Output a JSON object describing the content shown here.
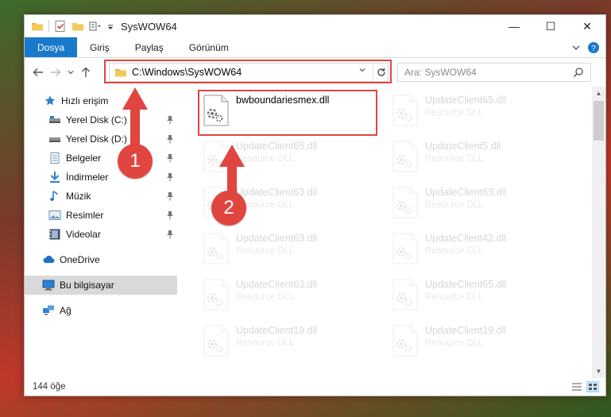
{
  "window": {
    "title": "SysWOW64",
    "controls": {
      "minimize": "—",
      "maximize": "☐",
      "close": "✕"
    }
  },
  "ribbon": {
    "tabs": [
      {
        "label": "Dosya",
        "active": true
      },
      {
        "label": "Giriş",
        "active": false
      },
      {
        "label": "Paylaş",
        "active": false
      },
      {
        "label": "Görünüm",
        "active": false
      }
    ]
  },
  "navigation": {
    "address": "C:\\Windows\\SysWOW64",
    "search_placeholder": "Ara: SysWOW64"
  },
  "sidebar": {
    "items": [
      {
        "label": "Hızlı erişim",
        "icon": "star-icon",
        "pinned": false
      },
      {
        "label": "Yerel Disk (C:)",
        "icon": "drive-icon",
        "pinned": true
      },
      {
        "label": "Yerel Disk (D:)",
        "icon": "drive-icon",
        "pinned": true
      },
      {
        "label": "Belgeler",
        "icon": "documents-icon",
        "pinned": true
      },
      {
        "label": "İndirmeler",
        "icon": "download-icon",
        "pinned": true
      },
      {
        "label": "Müzik",
        "icon": "music-icon",
        "pinned": true
      },
      {
        "label": "Resimler",
        "icon": "pictures-icon",
        "pinned": true
      },
      {
        "label": "Videolar",
        "icon": "videos-icon",
        "pinned": true
      },
      {
        "label": "OneDrive",
        "icon": "cloud-icon",
        "pinned": false
      },
      {
        "label": "Bu bilgisayar",
        "icon": "computer-icon",
        "pinned": false,
        "selected": true
      },
      {
        "label": "Ağ",
        "icon": "network-icon",
        "pinned": false
      }
    ]
  },
  "files": [
    {
      "name": "bwboundariesmex.dll",
      "type": "",
      "highlight": true
    },
    {
      "name": "UpdateClient65.dll",
      "type": "Resource DLL"
    },
    {
      "name": "UpdateClient65.dll",
      "type": "Resource DLL"
    },
    {
      "name": "UpdateClient5.dll",
      "type": "Resource DLL"
    },
    {
      "name": "UpdateClient63.dll",
      "type": "Resource DLL"
    },
    {
      "name": "UpdateClient63.dll",
      "type": "Resource DLL"
    },
    {
      "name": "UpdateClient63.dll",
      "type": "Resource DLL"
    },
    {
      "name": "UpdateClient42.dll",
      "type": "Resource DLL"
    },
    {
      "name": "UpdateClient63.dll",
      "type": "Resource DLL"
    },
    {
      "name": "UpdateClient65.dll",
      "type": "Resource DLL"
    },
    {
      "name": "UpdateClient19.dll",
      "type": "Resource DLL"
    },
    {
      "name": "UpdateClient19.dll",
      "type": "Resource DLL"
    }
  ],
  "status": {
    "item_count": "144 öğe"
  },
  "annotations": {
    "step1": "1",
    "step2": "2"
  },
  "colors": {
    "accent": "#1979ca",
    "annotation": "#e0463f"
  }
}
